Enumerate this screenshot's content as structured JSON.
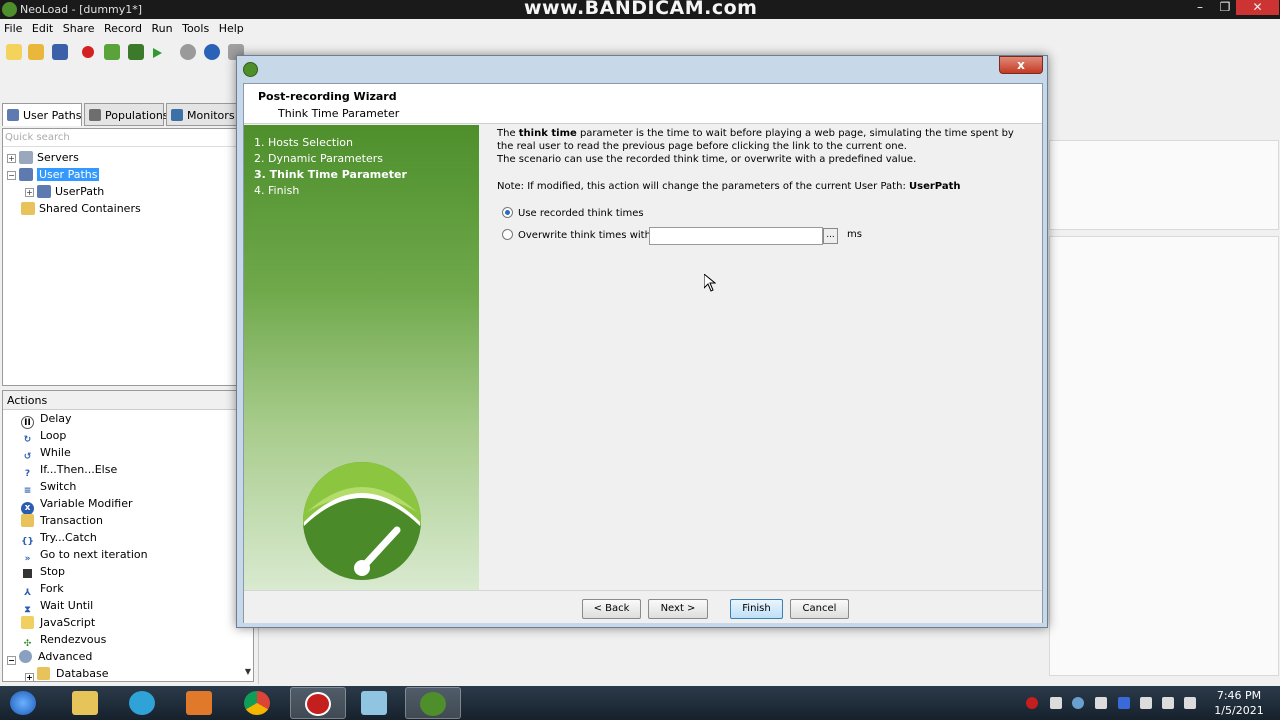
{
  "app": {
    "title": "NeoLoad - [dummy1*]",
    "watermark": "www.BANDICAM.com",
    "menu": [
      "File",
      "Edit",
      "Share",
      "Record",
      "Run",
      "Tools",
      "Help"
    ]
  },
  "left": {
    "tabs": [
      "User Paths",
      "Populations",
      "Monitors"
    ],
    "quick_search_placeholder": "Quick search",
    "tree": {
      "servers": "Servers",
      "user_paths": "User Paths",
      "user_path": "UserPath",
      "shared_containers": "Shared Containers"
    },
    "actions_header": "Actions",
    "actions": [
      "Delay",
      "Loop",
      "While",
      "If...Then...Else",
      "Switch",
      "Variable Modifier",
      "Transaction",
      "Try...Catch",
      "Go to next iteration",
      "Stop",
      "Fork",
      "Wait Until",
      "JavaScript",
      "Rendezvous",
      "Advanced",
      "Database"
    ]
  },
  "dialog": {
    "header_title": "Post-recording Wizard",
    "header_subtitle": "Think Time Parameter",
    "close_label": "x",
    "steps": [
      "1. Hosts Selection",
      "2. Dynamic Parameters",
      "3. Think Time Parameter",
      "4. Finish"
    ],
    "current_step": 2,
    "description": {
      "pre": "The ",
      "bold": "think time",
      "post": " parameter is the time to wait before playing a web page, simulating the time spent by the real user to read the previous page before clicking the link to the current one.",
      "line2": "The scenario can use the recorded think time, or overwrite with a predefined value."
    },
    "note": {
      "text": "Note: If modified, this action will change the parameters of the current User Path: ",
      "bold": "UserPath"
    },
    "options": {
      "use_recorded": "Use recorded think times",
      "overwrite": "Overwrite think times with:",
      "selected": "use_recorded"
    },
    "think_time_value": "",
    "browse_label": "...",
    "unit": "ms",
    "buttons": {
      "back": "< Back",
      "next": "Next >",
      "finish": "Finish",
      "cancel": "Cancel"
    }
  },
  "taskbar": {
    "time": "7:46 PM",
    "date": "1/5/2021"
  },
  "colors": {
    "neoload_green": "#4e8f2c",
    "selection_blue": "#3399ff"
  }
}
